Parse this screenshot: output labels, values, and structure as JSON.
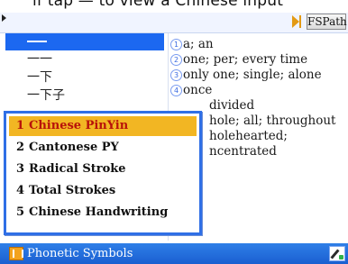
{
  "top_instruction": "if tap — to view a Chinese input",
  "toolbar": {
    "path_button": "FSPath"
  },
  "word_list": [
    {
      "text": "一",
      "selected": true
    },
    {
      "text": "一一",
      "selected": false
    },
    {
      "text": "一下",
      "selected": false
    },
    {
      "text": "一下子",
      "selected": false
    }
  ],
  "definition_lines": [
    {
      "marker": "1",
      "text": "a; an"
    },
    {
      "marker": "2",
      "text": "one; per; every time"
    },
    {
      "marker": "3",
      "text": "only one; single; alone"
    },
    {
      "marker": "4",
      "text": "once"
    },
    {
      "marker": "",
      "text": "divided"
    },
    {
      "marker": "",
      "text": "hole; all; throughout"
    },
    {
      "marker": "",
      "text": "holehearted;"
    },
    {
      "marker": "",
      "text": "ncentrated"
    }
  ],
  "input_menu": {
    "items": [
      {
        "num": "1",
        "label": "Chinese PinYin",
        "selected": true
      },
      {
        "num": "2",
        "label": "Cantonese PY",
        "selected": false
      },
      {
        "num": "3",
        "label": "Radical Stroke",
        "selected": false
      },
      {
        "num": "4",
        "label": "Total Strokes",
        "selected": false
      },
      {
        "num": "5",
        "label": "Chinese Handwriting",
        "selected": false
      }
    ]
  },
  "statusbar": {
    "label": "Phonetic Symbols"
  },
  "colors": {
    "selection_blue": "#1c68f0",
    "menu_highlight": "#f2b623",
    "menu_highlight_text": "#b8120a",
    "statusbar": "#2f7fe8"
  }
}
